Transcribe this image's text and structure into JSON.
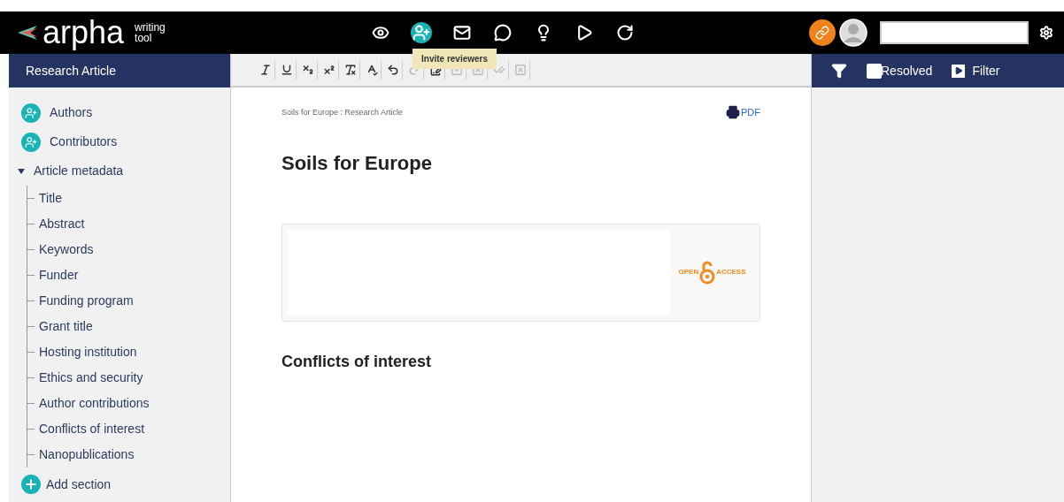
{
  "brand": {
    "logo": "arpha",
    "subtitle_line1": "writing",
    "subtitle_line2": "tool"
  },
  "top_nav": [
    {
      "kind": "preview",
      "active": false
    },
    {
      "kind": "invite",
      "active": true
    },
    {
      "kind": "mail",
      "active": false
    },
    {
      "kind": "comments",
      "active": false
    },
    {
      "kind": "hint",
      "active": false
    },
    {
      "kind": "tour",
      "active": false
    },
    {
      "kind": "refresh",
      "active": false
    }
  ],
  "tooltip": "Invite reviewers",
  "sidebar": {
    "title": "Research Article",
    "items": [
      {
        "label": "Authors",
        "kind": "person"
      },
      {
        "label": "Contributors",
        "kind": "person"
      },
      {
        "label": "Article metadata",
        "kind": "group",
        "expanded": true,
        "children": [
          {
            "label": "Title"
          },
          {
            "label": "Abstract"
          },
          {
            "label": "Keywords"
          },
          {
            "label": "Funder"
          },
          {
            "label": "Funding program"
          },
          {
            "label": "Grant title"
          },
          {
            "label": "Hosting institution"
          },
          {
            "label": "Ethics and security"
          },
          {
            "label": "Author contributions"
          },
          {
            "label": "Conflicts of interest"
          },
          {
            "label": "Nanopublications"
          }
        ]
      },
      {
        "label": "Add section",
        "kind": "add"
      }
    ]
  },
  "toolbar": [
    {
      "kind": "italic",
      "disabled": false
    },
    {
      "kind": "underline",
      "disabled": false
    },
    {
      "kind": "subscript",
      "disabled": false
    },
    {
      "kind": "superscript",
      "disabled": false
    },
    {
      "kind": "clear",
      "disabled": false
    },
    {
      "kind": "spell",
      "disabled": false
    },
    {
      "kind": "undo",
      "disabled": false
    },
    {
      "kind": "redo",
      "disabled": true
    },
    {
      "kind": "track",
      "disabled": false
    },
    {
      "kind": "accept",
      "disabled": true
    },
    {
      "kind": "reject",
      "disabled": true
    },
    {
      "kind": "accept-all",
      "disabled": true
    },
    {
      "kind": "reject-all",
      "disabled": true
    }
  ],
  "document": {
    "breadcrumb": "Soils for Europe : Research Article",
    "pdf": "PDF",
    "title": "Soils for Europe",
    "open_access_left": "OPEN",
    "open_access_right": "ACCESS",
    "section": "Conflicts of interest"
  },
  "comments_bar": {
    "resolved": {
      "label": "Resolved",
      "checked": false
    },
    "filter": "Filter"
  }
}
